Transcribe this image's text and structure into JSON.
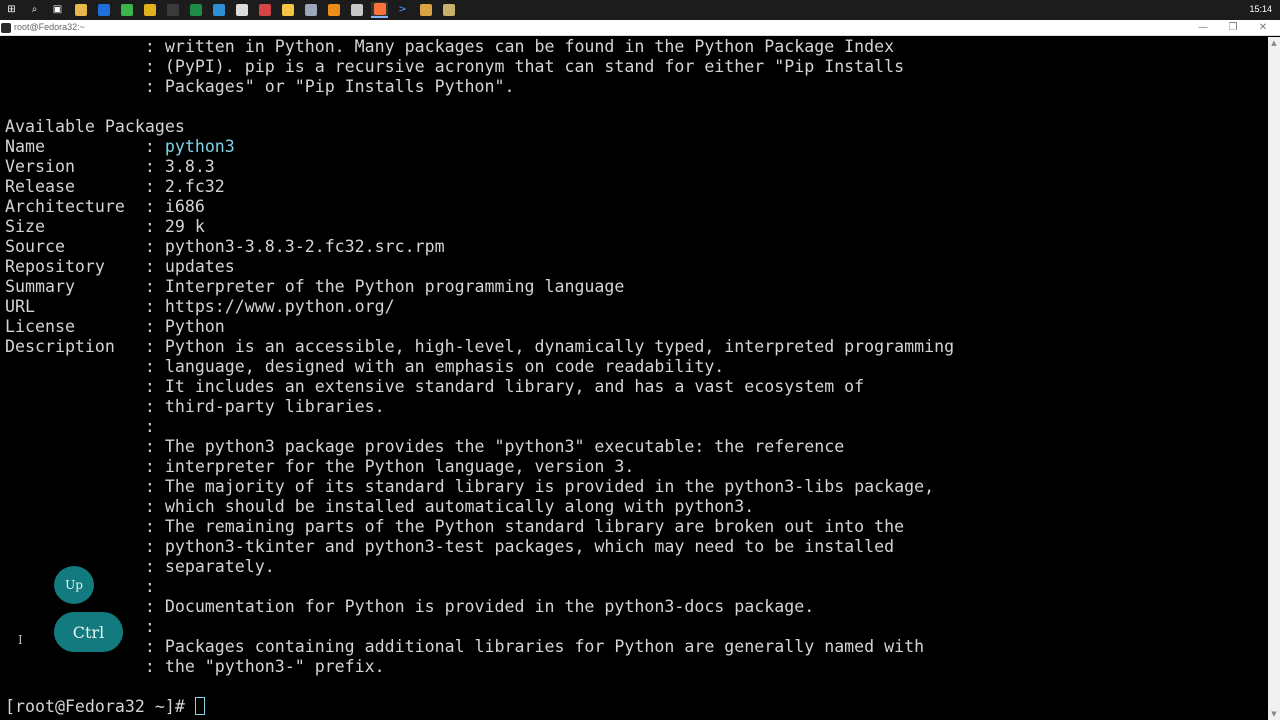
{
  "taskbar": {
    "icons": [
      {
        "name": "start-icon",
        "glyph": "⊞",
        "color": "#ffffff"
      },
      {
        "name": "search-icon",
        "glyph": "⌕",
        "color": "#ffffff"
      },
      {
        "name": "task-view-icon",
        "glyph": "▣",
        "color": "#ffffff"
      },
      {
        "name": "file-explorer-icon",
        "glyph": "",
        "color": "#e7b84a"
      },
      {
        "name": "remote-desktop-icon",
        "glyph": "",
        "color": "#1e6fd9"
      },
      {
        "name": "app-green-icon",
        "glyph": "",
        "color": "#3bb54a"
      },
      {
        "name": "chrome-icon",
        "glyph": "",
        "color": "#e0b020"
      },
      {
        "name": "app-dark-circle-icon",
        "glyph": "",
        "color": "#3a3a3a"
      },
      {
        "name": "excel-icon",
        "glyph": "",
        "color": "#1e8c45"
      },
      {
        "name": "edge-icon",
        "glyph": "",
        "color": "#2d8fd6"
      },
      {
        "name": "app-white-circle-icon",
        "glyph": "",
        "color": "#dddddd"
      },
      {
        "name": "app-red-icon",
        "glyph": "",
        "color": "#d64545"
      },
      {
        "name": "notes-icon",
        "glyph": "",
        "color": "#f4c542"
      },
      {
        "name": "network-icon",
        "glyph": "",
        "color": "#9aa8b8"
      },
      {
        "name": "vlc-icon",
        "glyph": "",
        "color": "#f08c1a"
      },
      {
        "name": "app-box-icon",
        "glyph": "",
        "color": "#c8c8c8"
      },
      {
        "name": "firefox-icon",
        "glyph": "",
        "color": "#ff7139"
      },
      {
        "name": "terminal-icon",
        "glyph": ">",
        "color": "#4aa0ff"
      },
      {
        "name": "app-tools-icon",
        "glyph": "",
        "color": "#d9a441"
      },
      {
        "name": "putty-icon",
        "glyph": "",
        "color": "#c9b26a"
      }
    ],
    "active_index": 16,
    "clock": "15:14"
  },
  "window": {
    "title": "root@Fedora32:~",
    "minimize": "—",
    "maximize": "❐",
    "close": "✕"
  },
  "terminal": {
    "lines": [
      {
        "pre": "              : written in Python. Many packages can be found in the Python Package Index",
        "hl": "",
        "post": ""
      },
      {
        "pre": "              : (PyPI). pip is a recursive acronym that can stand for either \"Pip Installs",
        "hl": "",
        "post": ""
      },
      {
        "pre": "              : Packages\" or \"Pip Installs Python\".",
        "hl": "",
        "post": ""
      },
      {
        "pre": "",
        "hl": "",
        "post": ""
      },
      {
        "pre": "Available Packages",
        "hl": "",
        "post": ""
      },
      {
        "pre": "Name          : ",
        "hl": "python3",
        "post": ""
      },
      {
        "pre": "Version       : 3.8.3",
        "hl": "",
        "post": ""
      },
      {
        "pre": "Release       : 2.fc32",
        "hl": "",
        "post": ""
      },
      {
        "pre": "Architecture  : i686",
        "hl": "",
        "post": ""
      },
      {
        "pre": "Size          : 29 k",
        "hl": "",
        "post": ""
      },
      {
        "pre": "Source        : python3-3.8.3-2.fc32.src.rpm",
        "hl": "",
        "post": ""
      },
      {
        "pre": "Repository    : updates",
        "hl": "",
        "post": ""
      },
      {
        "pre": "Summary       : Interpreter of the Python programming language",
        "hl": "",
        "post": ""
      },
      {
        "pre": "URL           : https://www.python.org/",
        "hl": "",
        "post": ""
      },
      {
        "pre": "License       : Python",
        "hl": "",
        "post": ""
      },
      {
        "pre": "Description   : Python is an accessible, high-level, dynamically typed, interpreted programming",
        "hl": "",
        "post": ""
      },
      {
        "pre": "              : language, designed with an emphasis on code readability.",
        "hl": "",
        "post": ""
      },
      {
        "pre": "              : It includes an extensive standard library, and has a vast ecosystem of",
        "hl": "",
        "post": ""
      },
      {
        "pre": "              : third-party libraries.",
        "hl": "",
        "post": ""
      },
      {
        "pre": "              :",
        "hl": "",
        "post": ""
      },
      {
        "pre": "              : The python3 package provides the \"python3\" executable: the reference",
        "hl": "",
        "post": ""
      },
      {
        "pre": "              : interpreter for the Python language, version 3.",
        "hl": "",
        "post": ""
      },
      {
        "pre": "              : The majority of its standard library is provided in the python3-libs package,",
        "hl": "",
        "post": ""
      },
      {
        "pre": "              : which should be installed automatically along with python3.",
        "hl": "",
        "post": ""
      },
      {
        "pre": "              : The remaining parts of the Python standard library are broken out into the",
        "hl": "",
        "post": ""
      },
      {
        "pre": "              : python3-tkinter and python3-test packages, which may need to be installed",
        "hl": "",
        "post": ""
      },
      {
        "pre": "              : separately.",
        "hl": "",
        "post": ""
      },
      {
        "pre": "              :",
        "hl": "",
        "post": ""
      },
      {
        "pre": "              : Documentation for Python is provided in the python3-docs package.",
        "hl": "",
        "post": ""
      },
      {
        "pre": "              :",
        "hl": "",
        "post": ""
      },
      {
        "pre": "              : Packages containing additional libraries for Python are generally named with",
        "hl": "",
        "post": ""
      },
      {
        "pre": "              : the \"python3-\" prefix.",
        "hl": "",
        "post": ""
      },
      {
        "pre": "",
        "hl": "",
        "post": ""
      }
    ],
    "prompt": "[root@Fedora32 ~]# "
  },
  "scrollbar": {
    "up_arrow": "▲",
    "down_arrow": "▼"
  },
  "keys": {
    "up": "Up",
    "ctrl": "Ctrl"
  },
  "mouse_glyph": "I"
}
